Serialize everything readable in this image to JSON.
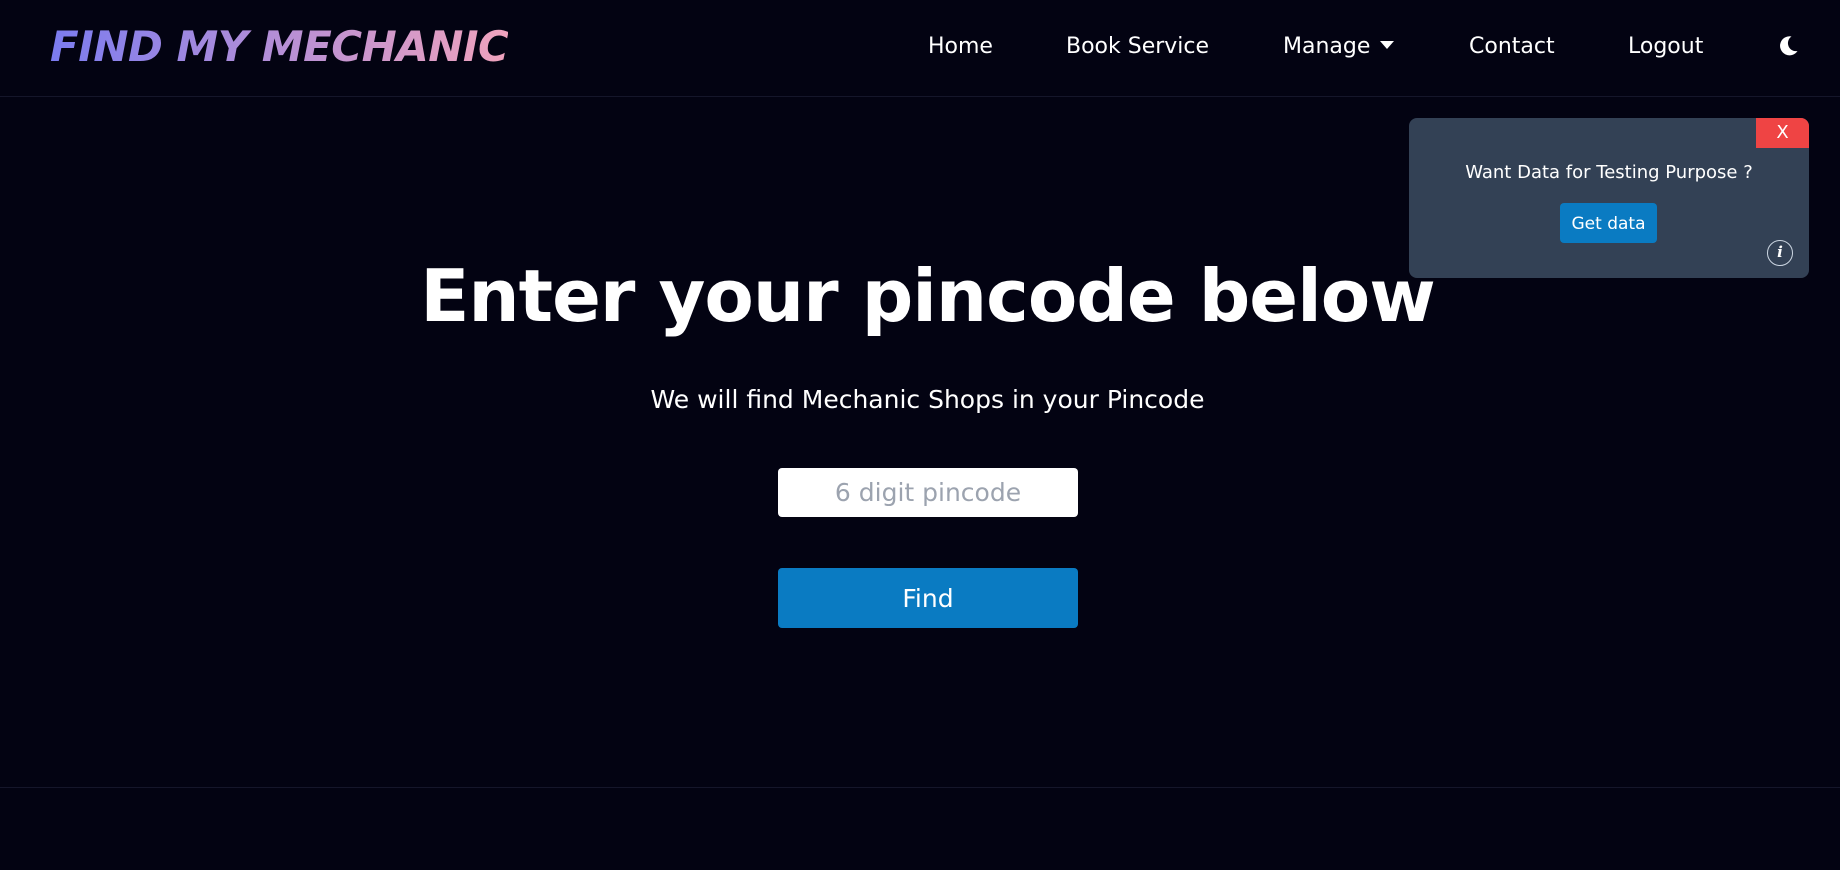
{
  "navbar": {
    "logo_text": "FIND MY MECHANIC",
    "items": {
      "home": "Home",
      "book_service": "Book Service",
      "manage": "Manage",
      "contact": "Contact",
      "logout": "Logout"
    },
    "theme_icon": "moon-icon"
  },
  "popup": {
    "close_label": "X",
    "message": "Want Data for Testing Purpose ?",
    "button_label": "Get data",
    "info_label": "i"
  },
  "main": {
    "title": "Enter your pincode below",
    "subtitle": "We will find Mechanic Shops in your Pincode",
    "pincode_placeholder": "6 digit pincode",
    "pincode_value": "",
    "find_label": "Find"
  },
  "colors": {
    "background": "#030312",
    "accent_blue": "#0a7bc2",
    "popup_bg": "#334155",
    "close_red": "#ef4444",
    "logo_gradient_start": "#7b7cf0",
    "logo_gradient_end": "#f0a3bd"
  }
}
